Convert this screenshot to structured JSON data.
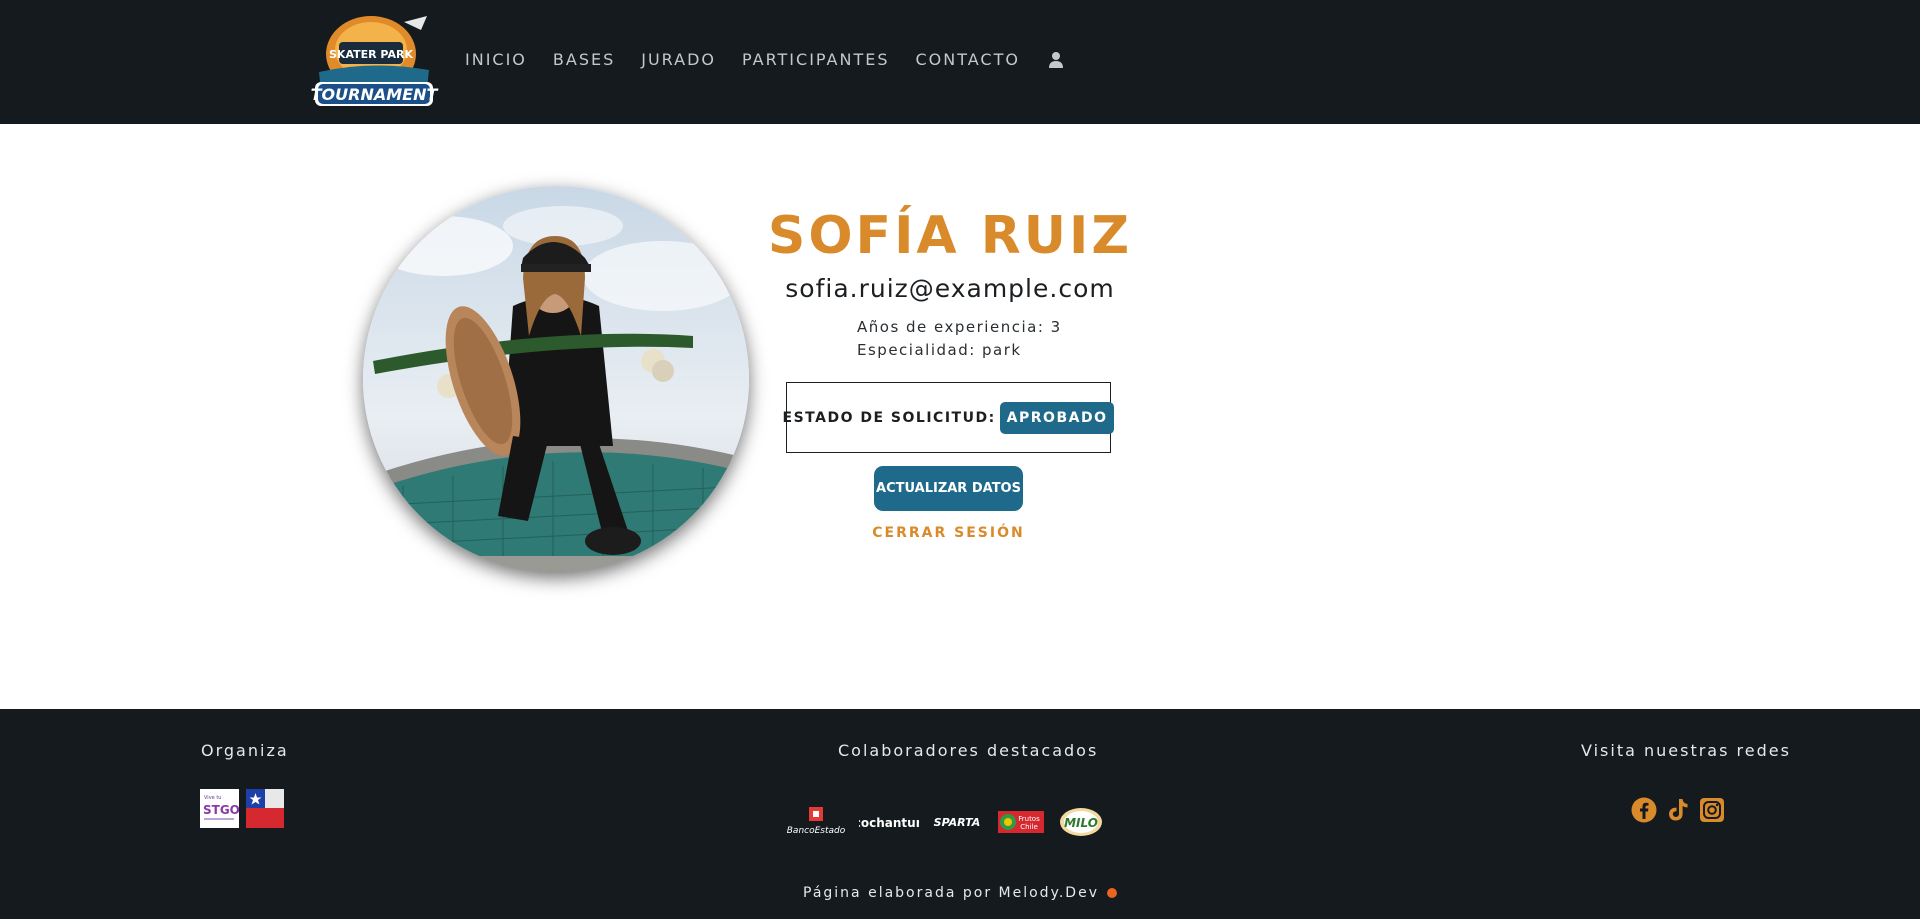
{
  "header": {
    "logo_text": "SKATER PARK TOURNAMENT",
    "nav": [
      "INICIO",
      "BASES",
      "JURADO",
      "PARTICIPANTES",
      "CONTACTO"
    ],
    "user_icon": "user-icon"
  },
  "profile": {
    "name": "SOFÍA RUIZ",
    "email": "sofia.ruiz@example.com",
    "experience": "Años de experiencia: 3",
    "specialty": "Especialidad: park",
    "status_label": "ESTADO DE SOLICITUD:",
    "status_value": "APROBADO",
    "update_button": "ACTUALIZAR DATOS",
    "logout_link": "CERRAR SESIÓN"
  },
  "footer": {
    "organiza_title": "Organiza",
    "collab_title": "Colaboradores destacados",
    "social_title": "Visita nuestras redes",
    "org_logos": [
      "Vive tu STGO",
      "Gobierno de Chile"
    ],
    "collab_logos": [
      "BancoEstado",
      "cochrantun",
      "SPARTA",
      "Frutos Chile",
      "MILO"
    ],
    "social_icons": [
      "facebook-icon",
      "tiktok-icon",
      "instagram-icon"
    ],
    "credit": "Página elaborada por Melody.Dev"
  },
  "colors": {
    "accent_orange": "#d98a2b",
    "primary_blue": "#1f6a8a",
    "dark_bg": "#141a1d"
  }
}
